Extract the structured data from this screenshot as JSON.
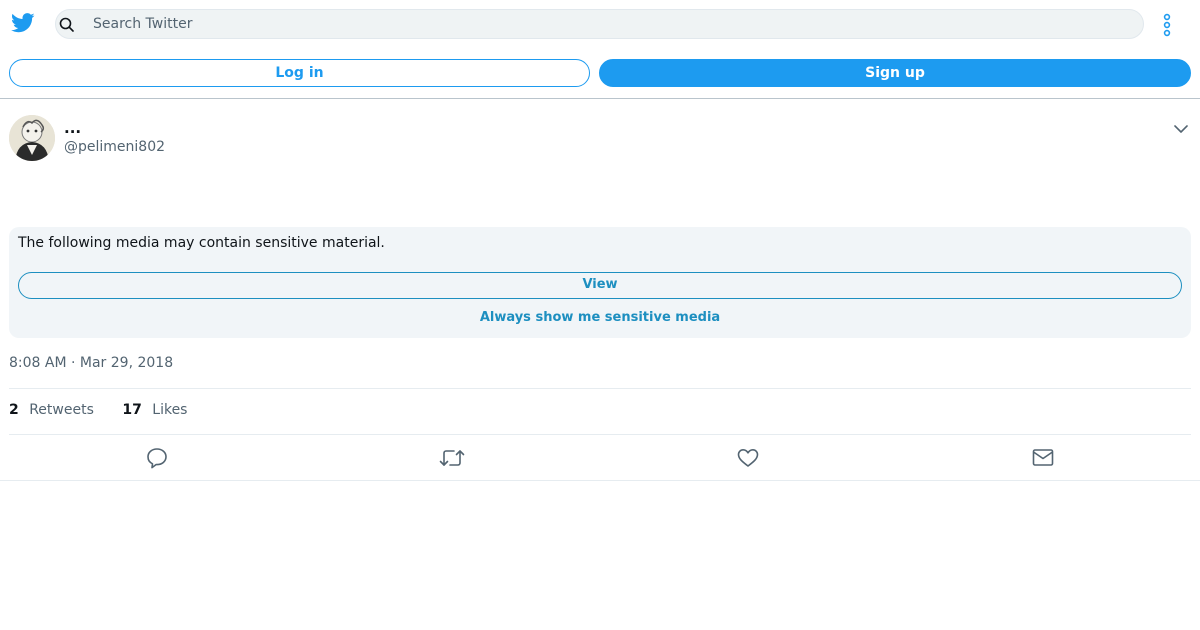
{
  "search": {
    "placeholder": "Search Twitter"
  },
  "auth": {
    "login_label": "Log in",
    "signup_label": "Sign up"
  },
  "tweet": {
    "display_name": "...",
    "handle": "@pelimeni802",
    "sensitive_notice": "The following media may contain sensitive material.",
    "view_label": "View",
    "always_show_label": "Always show me sensitive media",
    "timestamp": "8:08 AM · Mar 29, 2018",
    "retweets_count": "2",
    "retweets_label": "Retweets",
    "likes_count": "17",
    "likes_label": "Likes"
  },
  "icons": {
    "logo": "twitter-bird-icon",
    "search": "search-icon",
    "more": "more-vertical-icon",
    "caret": "chevron-down-icon",
    "reply": "reply-icon",
    "retweet": "retweet-icon",
    "like": "heart-icon",
    "dm": "mail-icon"
  },
  "colors": {
    "accent": "#1d9bf0",
    "link": "#1d8fc0",
    "secondary_text": "#536471"
  }
}
